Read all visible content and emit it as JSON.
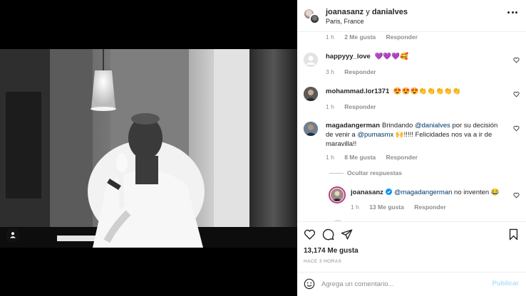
{
  "post": {
    "author_1": "joanasanz",
    "conjunction": "y",
    "author_2": "danialves",
    "location": "Paris, France"
  },
  "caption_meta": {
    "time": "1 h",
    "likes": "2 Me gusta",
    "reply": "Responder"
  },
  "comments": [
    {
      "user": "happyyy_love",
      "text": "💜💜💜🥰",
      "time": "3 h",
      "reply": "Responder"
    },
    {
      "user": "mohammad.lor1371",
      "text": "😍😍😍👏👏👏👏👏",
      "time": "1 h",
      "reply": "Responder"
    },
    {
      "user": "magadangerman",
      "text_pre": "Brindando ",
      "mention_1": "@danialves",
      "text_mid": " por su decisión de venir a ",
      "mention_2": "@pumasmx",
      "text_post": " 🙌!!!!! Felicidades nos va a ir de maravilla!!",
      "time": "1 h",
      "likes": "8 Me gusta",
      "reply": "Responder"
    }
  ],
  "replies_toggle": "Ocultar respuestas",
  "reply": {
    "user": "joanasanz",
    "verified": true,
    "mention": "@magadangerman",
    "text": " no inventen 😂",
    "time": "1 h",
    "likes": "13 Me gusta",
    "reply": "Responder"
  },
  "stats": {
    "likes": "13,174 Me gusta",
    "ago": "HACE 3 HORAS"
  },
  "composer": {
    "placeholder": "Agrega un comentario...",
    "publish": "Publicar"
  },
  "icons": {
    "more": "more-horizontal-icon",
    "heart": "heart-outline-icon",
    "comment": "comment-bubble-icon",
    "share": "paper-plane-icon",
    "save": "bookmark-icon",
    "emoji": "smiley-icon",
    "tag": "user-tag-icon",
    "verified": "verified-badge-icon"
  },
  "colors": {
    "mention": "#00376b",
    "secondary": "#8e8e8e",
    "publish_disabled": "#b2dffc",
    "verified": "#0095f6"
  }
}
